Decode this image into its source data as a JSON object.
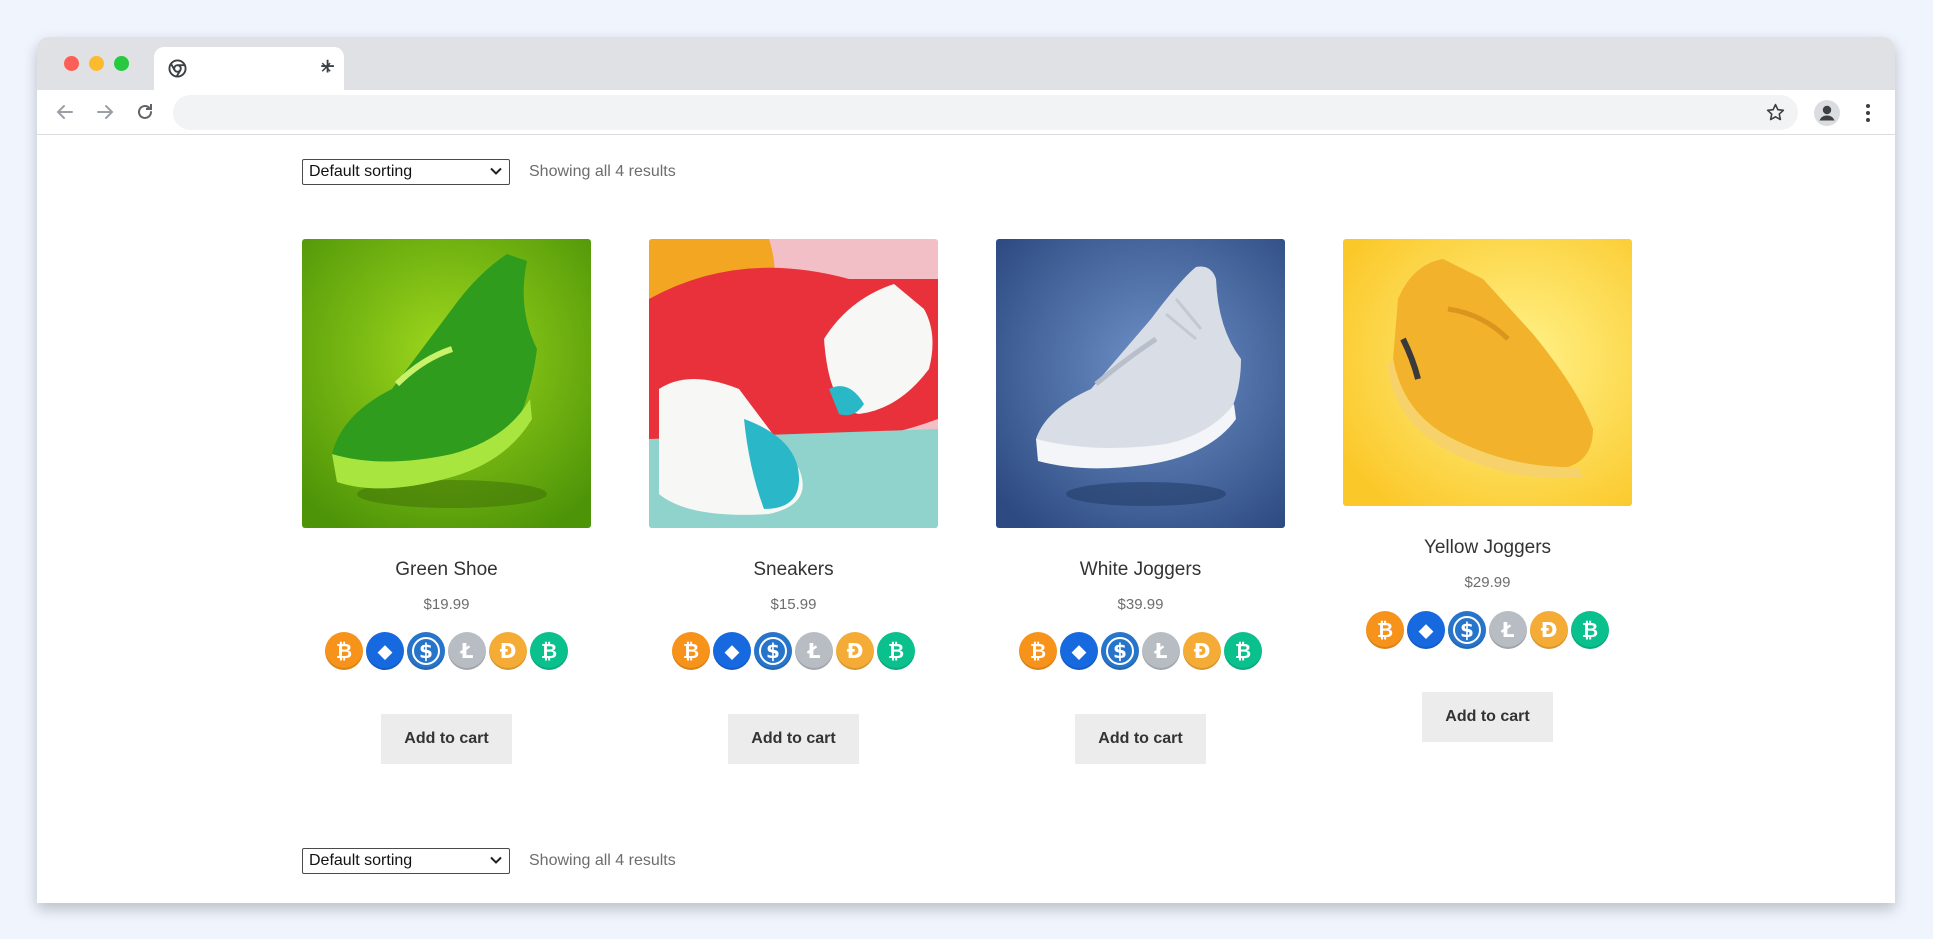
{
  "browser": {
    "tab_close": "×",
    "new_tab": "+",
    "address_value": ""
  },
  "shop": {
    "sort_selected": "Default sorting",
    "result_count": "Showing all 4 results",
    "currency_icons": [
      "bitcoin-icon",
      "ethereum-icon",
      "usdc-icon",
      "litecoin-icon",
      "dai-icon",
      "bitcoin-cash-icon"
    ],
    "coin_glyphs": [
      "₿",
      "⬥",
      "$",
      "Ł",
      "Đ",
      "₿"
    ],
    "products": [
      {
        "title": "Green Shoe",
        "price": "$19.99",
        "button": "Add to cart",
        "image_color": "#5aa60f"
      },
      {
        "title": "Sneakers",
        "price": "$15.99",
        "button": "Add to cart",
        "image_color": "#e8313a"
      },
      {
        "title": "White Joggers",
        "price": "$39.99",
        "button": "Add to cart",
        "image_color": "#3e62a0"
      },
      {
        "title": "Yellow Joggers",
        "price": "$29.99",
        "button": "Add to cart",
        "image_color": "#fbd13c"
      }
    ]
  }
}
